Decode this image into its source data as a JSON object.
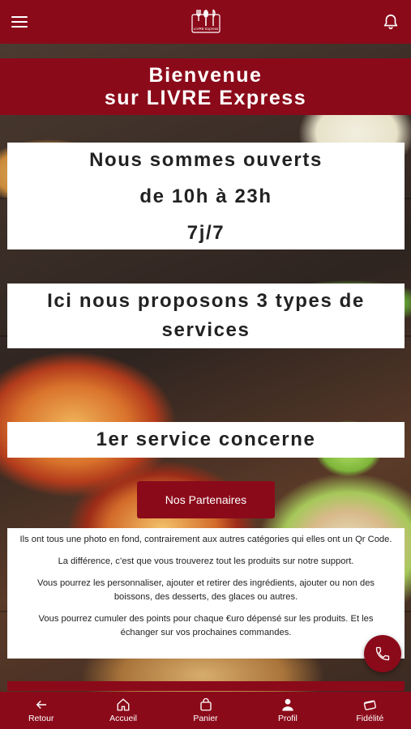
{
  "app_bar": {
    "menu_icon": "hamburger-menu-icon",
    "logo_icon": "restaurant-logo-icon",
    "logo_text": "LIVRE Express",
    "notification_icon": "bell-icon"
  },
  "welcome": {
    "line1": "Bienvenue",
    "line2": "sur LIVRE Express"
  },
  "hours": {
    "line1": "Nous sommes ouverts",
    "line2": "de 10h à 23h",
    "line3": "7j/7"
  },
  "services": {
    "line1": "Ici nous proposons 3 types de",
    "line2": "services"
  },
  "service1": {
    "title": "1er service concerne"
  },
  "partners_button": "Nos Partenaires",
  "description": [
    "Ils ont tous une photo en fond, contrairement aux autres catégories qui elles ont un Qr Code.",
    "La différence, c’est que vous trouverez tout les produits sur notre support.",
    "Vous pourrez les personnaliser, ajouter et retirer des ingrédients, ajouter ou non des boissons, des desserts, des glaces ou autres.",
    "Vous pourrez cumuler des points pour chaque €uro dépensé sur les produits. Et les échanger sur vos prochaines commandes."
  ],
  "call_button_icon": "phone-icon",
  "bottom_nav": [
    {
      "label": "Retour",
      "icon": "arrow-left-icon"
    },
    {
      "label": "Accueil",
      "icon": "home-icon"
    },
    {
      "label": "Panier",
      "icon": "bag-icon"
    },
    {
      "label": "Profil",
      "icon": "person-icon"
    },
    {
      "label": "Fidélité",
      "icon": "loyalty-card-icon"
    }
  ],
  "colors": {
    "brand": "#8b0a1a",
    "panel": "#ffffff",
    "text": "#222222"
  }
}
